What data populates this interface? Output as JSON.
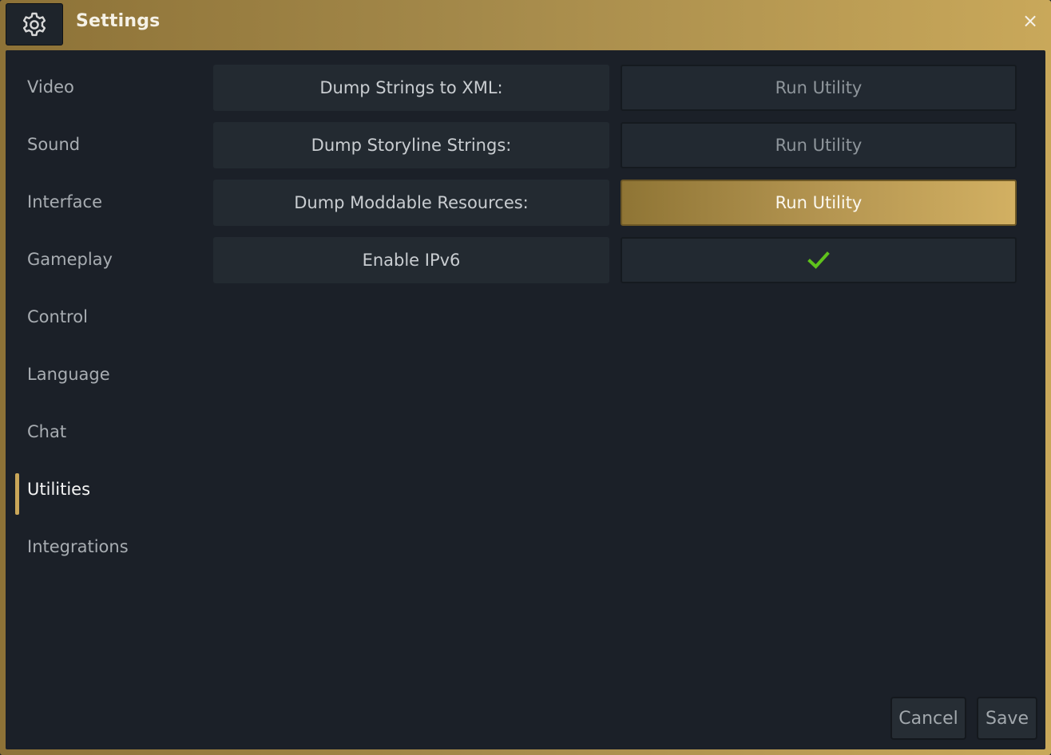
{
  "window": {
    "title": "Settings",
    "close_glyph": "×",
    "settings_icon": "gear-icon"
  },
  "sidebar": {
    "items": [
      {
        "label": "Video"
      },
      {
        "label": "Sound"
      },
      {
        "label": "Interface"
      },
      {
        "label": "Gameplay"
      },
      {
        "label": "Control"
      },
      {
        "label": "Language"
      },
      {
        "label": "Chat"
      },
      {
        "label": "Utilities",
        "active": true
      },
      {
        "label": "Integrations"
      }
    ]
  },
  "utilities": {
    "rows": [
      {
        "label": "Dump Strings to XML:",
        "action": "Run Utility"
      },
      {
        "label": "Dump Storyline Strings:",
        "action": "Run Utility"
      },
      {
        "label": "Dump Moddable Resources:",
        "action": "Run Utility",
        "highlighted": true
      },
      {
        "label": "Enable IPv6",
        "checked": true,
        "check_icon": "checkmark-icon",
        "check_color": "#5fc21c"
      }
    ]
  },
  "footer": {
    "cancel_label": "Cancel",
    "save_label": "Save"
  },
  "colors": {
    "accent_gold": "#c9a659",
    "panel_bg": "#1b2028",
    "cell_bg": "#232a31"
  }
}
